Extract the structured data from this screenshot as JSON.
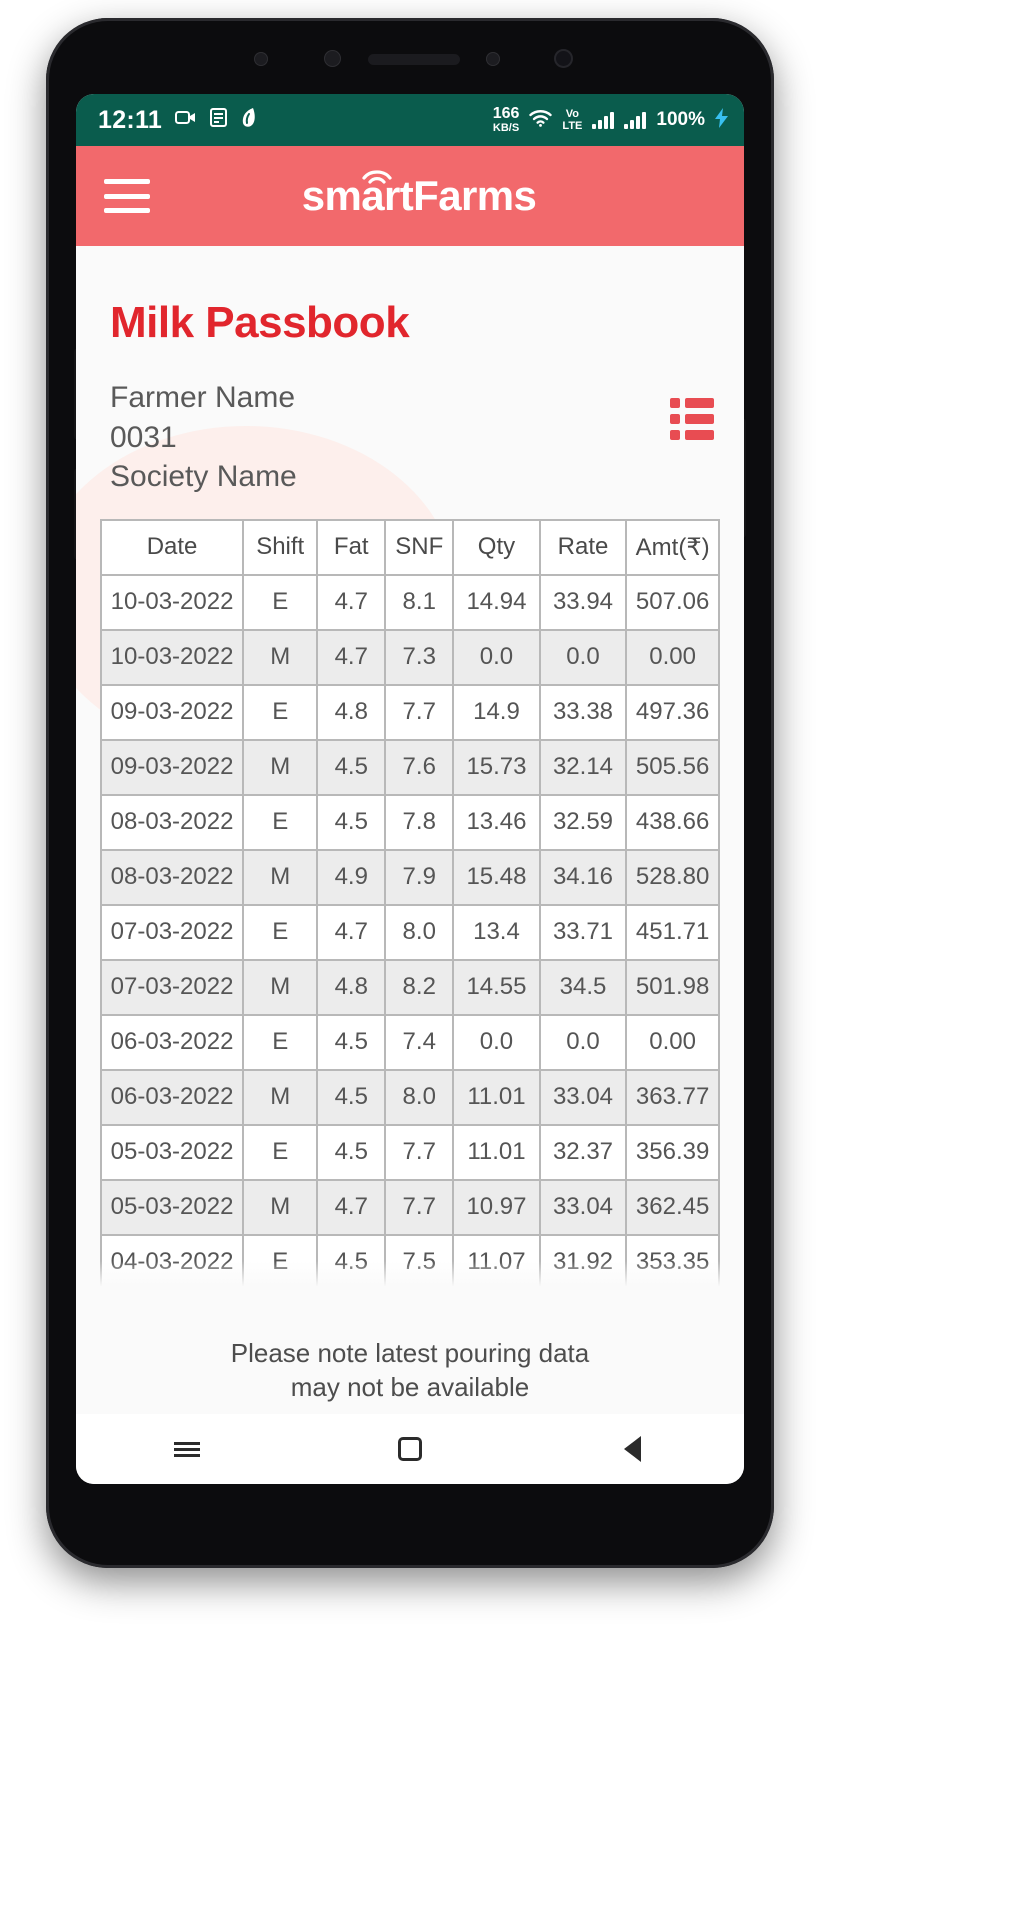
{
  "status_bar": {
    "time": "12:11",
    "icons": [
      "camera-icon",
      "document-icon",
      "app-icon"
    ],
    "net_speed_value": "166",
    "net_speed_unit": "KB/S",
    "wifi": "wifi-icon",
    "volte_line1": "Vo",
    "volte_line2": "LTE",
    "signal1": "signal-bars-icon",
    "signal2": "signal-bars-icon",
    "battery_percent": "100%",
    "charging": "charging-bolt-icon",
    "bg_color": "#0a5c4d"
  },
  "app_bar": {
    "menu": "hamburger-menu-icon",
    "brand": "smartFarms",
    "bg_color": "#f2696c"
  },
  "page": {
    "title": "Milk Passbook",
    "title_color": "#e1262d",
    "farmer_name": "Farmer Name",
    "farmer_code": "0031",
    "society_name": "Society Name",
    "list_view_icon": "list-view-icon",
    "footer_note_line1": "Please note latest pouring data",
    "footer_note_line2": "may not be available"
  },
  "table": {
    "headers": [
      "Date",
      "Shift",
      "Fat",
      "SNF",
      "Qty",
      "Rate",
      "Amt(₹)"
    ],
    "rows": [
      [
        "10-03-2022",
        "E",
        "4.7",
        "8.1",
        "14.94",
        "33.94",
        "507.06"
      ],
      [
        "10-03-2022",
        "M",
        "4.7",
        "7.3",
        "0.0",
        "0.0",
        "0.00"
      ],
      [
        "09-03-2022",
        "E",
        "4.8",
        "7.7",
        "14.9",
        "33.38",
        "497.36"
      ],
      [
        "09-03-2022",
        "M",
        "4.5",
        "7.6",
        "15.73",
        "32.14",
        "505.56"
      ],
      [
        "08-03-2022",
        "E",
        "4.5",
        "7.8",
        "13.46",
        "32.59",
        "438.66"
      ],
      [
        "08-03-2022",
        "M",
        "4.9",
        "7.9",
        "15.48",
        "34.16",
        "528.80"
      ],
      [
        "07-03-2022",
        "E",
        "4.7",
        "8.0",
        "13.4",
        "33.71",
        "451.71"
      ],
      [
        "07-03-2022",
        "M",
        "4.8",
        "8.2",
        "14.55",
        "34.5",
        "501.98"
      ],
      [
        "06-03-2022",
        "E",
        "4.5",
        "7.4",
        "0.0",
        "0.0",
        "0.00"
      ],
      [
        "06-03-2022",
        "M",
        "4.5",
        "8.0",
        "11.01",
        "33.04",
        "363.77"
      ],
      [
        "05-03-2022",
        "E",
        "4.5",
        "7.7",
        "11.01",
        "32.37",
        "356.39"
      ],
      [
        "05-03-2022",
        "M",
        "4.7",
        "7.7",
        "10.97",
        "33.04",
        "362.45"
      ],
      [
        "04-03-2022",
        "E",
        "4.5",
        "7.5",
        "11.07",
        "31.92",
        "353.35"
      ]
    ]
  },
  "nav_bar": {
    "recents": "recents-icon",
    "home": "home-icon",
    "back": "back-icon"
  }
}
